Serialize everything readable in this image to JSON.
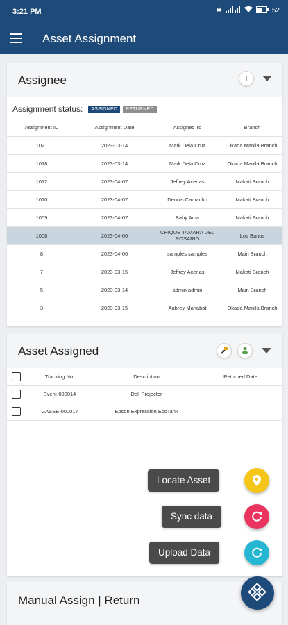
{
  "status_bar": {
    "time": "3:21 PM",
    "battery": "52"
  },
  "app_bar": {
    "title": "Asset Assignment"
  },
  "assignee": {
    "title": "Assignee",
    "status_label": "Assignment status:",
    "badges": [
      {
        "label": "ASSIGNED",
        "color": "#1d4a78"
      },
      {
        "label": "RETURNED",
        "color": "#8e8e8e"
      }
    ],
    "columns": [
      "Assignment ID",
      "Assignment Date",
      "Assigned To",
      "Branch"
    ],
    "rows": [
      [
        "1021",
        "2023-03-14",
        "Mark Dela Cruz",
        "Okada Manila Branch"
      ],
      [
        "1018",
        "2023-03-14",
        "Mark Dela Cruz",
        "Okada Manila Branch"
      ],
      [
        "1012",
        "2023-04-07",
        "Jeffrey Acenas",
        "Makati Branch"
      ],
      [
        "1010",
        "2023-04-07",
        "Dennis Camacho",
        "Makati Branch"
      ],
      [
        "1009",
        "2023-04-07",
        "Baby Ama",
        "Makati Branch"
      ],
      [
        "1008",
        "2023-04-06",
        "CHIQUE TAMARA DEL ROSARIO",
        "Los Banos"
      ],
      [
        "8",
        "2023-04-06",
        "samples samples",
        "Main Branch"
      ],
      [
        "7",
        "2023-03-15",
        "Jeffrey Acenas",
        "Makati Branch"
      ],
      [
        "5",
        "2023-03-14",
        "admin admin",
        "Main Branch"
      ],
      [
        "3",
        "2023-03-15",
        "Aubrey Manabat",
        "Okada Manila Branch"
      ]
    ]
  },
  "asset_assigned": {
    "title": "Asset Assigned",
    "columns": [
      "Tracking No.",
      "Description",
      "Returned Date"
    ],
    "rows": [
      [
        "Event-000014",
        "Dell Projector",
        ""
      ],
      [
        "GASSE-000017",
        "Epson Expression EcoTank",
        ""
      ]
    ]
  },
  "fab_menu": {
    "locate": {
      "label": "Locate Asset",
      "color": "#f5c518"
    },
    "sync": {
      "label": "Sync data",
      "color": "#e8345e"
    },
    "upload": {
      "label": "Upload Data",
      "color": "#27b6d1"
    }
  },
  "manual": {
    "title": "Manual Assign | Return"
  }
}
